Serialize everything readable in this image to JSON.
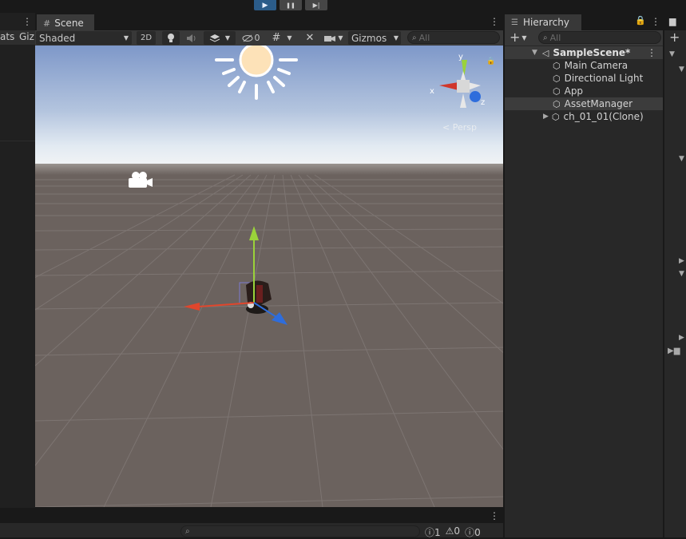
{
  "playbar": {
    "play_icon": "play-icon",
    "pause_icon": "pause-icon",
    "step_icon": "step-icon",
    "play_glyph": "▶",
    "pause_glyph": "❚❚",
    "step_glyph": "▶|"
  },
  "left_panel": {
    "tab1": "ats",
    "tab2": "Giz"
  },
  "scene": {
    "tab_label": "Scene",
    "shading": "Shaded",
    "mode_2d": "2D",
    "hidden_count": "0",
    "gizmos": "Gizmos",
    "search_placeholder": "All",
    "persp_label": "< Persp",
    "axis_x": "x",
    "axis_y": "y",
    "axis_z": "z",
    "colors": {
      "sky_top": "#7e98c9",
      "horizon": "#e6eef5",
      "ground": "#6b625e",
      "grid": "#807874",
      "x_axis": "#e0462c",
      "y_axis": "#9ad23a",
      "z_axis": "#2e6ddc"
    }
  },
  "hierarchy": {
    "tab_label": "Hierarchy",
    "search_placeholder": "All",
    "scene_name": "SampleScene*",
    "items": [
      {
        "label": "Main Camera",
        "expandable": false,
        "selected": false
      },
      {
        "label": "Directional Light",
        "expandable": false,
        "selected": false
      },
      {
        "label": "App",
        "expandable": false,
        "selected": false
      },
      {
        "label": "AssetManager",
        "expandable": false,
        "selected": true
      },
      {
        "label": "ch_01_01(Clone)",
        "expandable": true,
        "selected": false
      }
    ]
  },
  "console": {
    "errors": "1",
    "warnings": "0",
    "messages": "0"
  }
}
